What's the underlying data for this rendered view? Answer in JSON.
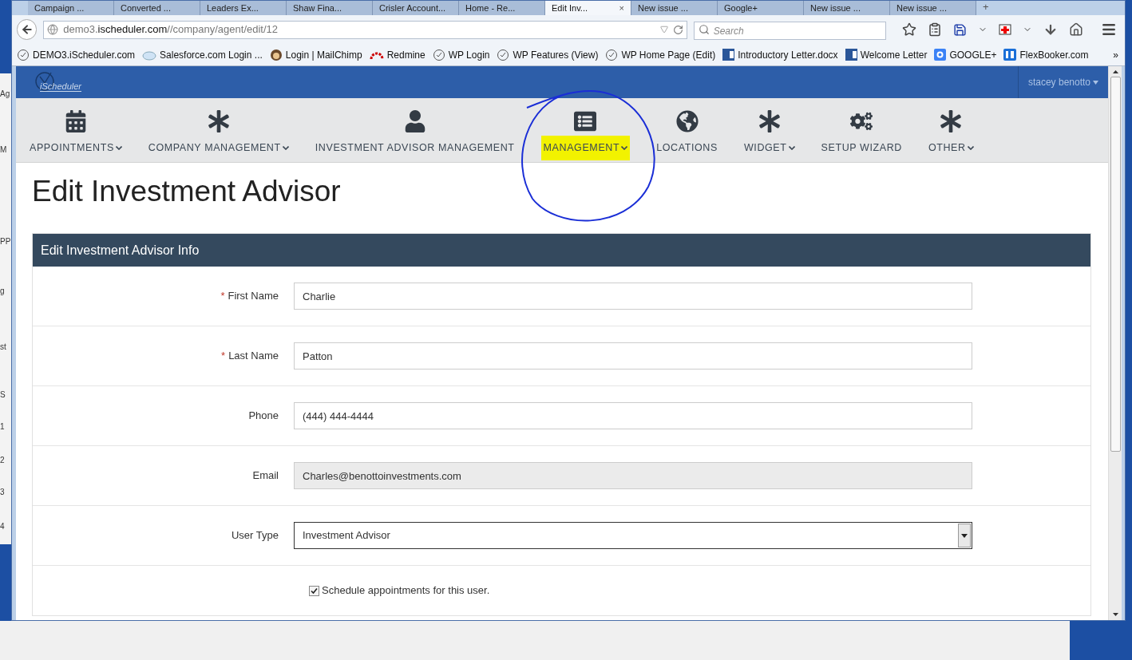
{
  "browser": {
    "tabs": [
      {
        "label": "Campaign ...",
        "selected": false
      },
      {
        "label": "Converted ...",
        "selected": false
      },
      {
        "label": "Leaders Ex...",
        "selected": false
      },
      {
        "label": "Shaw Fina...",
        "selected": false
      },
      {
        "label": "Crisler Account...",
        "selected": false
      },
      {
        "label": "Home - Re...",
        "selected": false
      },
      {
        "label": "Edit Inv...",
        "selected": true,
        "close": "×"
      },
      {
        "label": "New issue ...",
        "selected": false
      },
      {
        "label": "Google+",
        "selected": false
      },
      {
        "label": "New issue ...",
        "selected": false
      },
      {
        "label": "New issue ...",
        "selected": false
      }
    ],
    "new_tab": "+",
    "url": {
      "prefix": "demo3.",
      "host": "ischeduler.com",
      "path": "//company/agent/edit/12"
    },
    "search": {
      "placeholder": "Search"
    },
    "bookmarks": [
      {
        "label": "DEMO3.iScheduler.com",
        "kind": "clock"
      },
      {
        "label": "Salesforce.com Login ...",
        "kind": "cloud"
      },
      {
        "label": "Login | MailChimp",
        "kind": "chimp"
      },
      {
        "label": "Redmine",
        "kind": "redmine"
      },
      {
        "label": "WP Login",
        "kind": "clock"
      },
      {
        "label": "WP Features (View)",
        "kind": "clock"
      },
      {
        "label": "WP Home Page (Edit)",
        "kind": "clock"
      },
      {
        "label": "Introductory Letter.docx",
        "kind": "word"
      },
      {
        "label": "Welcome Letter",
        "kind": "word"
      },
      {
        "label": "GOOGLE+",
        "kind": "google"
      },
      {
        "label": "FlexBooker.com",
        "kind": "fb"
      }
    ],
    "overflow": "»"
  },
  "header": {
    "logo": "iScheduler",
    "user": "stacey benotto"
  },
  "menu": [
    {
      "label": "APPOINTMENTS",
      "kind": "calendar",
      "dropdown": true,
      "highlighted": false,
      "circled": false
    },
    {
      "label": "COMPANY MANAGEMENT",
      "kind": "asterisk",
      "dropdown": true,
      "highlighted": false,
      "circled": false
    },
    {
      "label": "INVESTMENT ADVISOR MANAGEMENT",
      "kind": "user",
      "dropdown": false,
      "highlighted": false,
      "circled": false
    },
    {
      "label": "MANAGEMENT",
      "kind": "list",
      "dropdown": true,
      "highlighted": true,
      "circled": true
    },
    {
      "label": "LOCATIONS",
      "kind": "globe",
      "dropdown": false,
      "highlighted": false,
      "circled": false
    },
    {
      "label": "WIDGET",
      "kind": "asterisk",
      "dropdown": true,
      "highlighted": false,
      "circled": false
    },
    {
      "label": "SETUP WIZARD",
      "kind": "cogs",
      "dropdown": false,
      "highlighted": false,
      "circled": false
    },
    {
      "label": "OTHER",
      "kind": "asterisk",
      "dropdown": true,
      "highlighted": false,
      "circled": false
    }
  ],
  "page_title": "Edit Investment Advisor",
  "panel": {
    "title": "Edit Investment Advisor Info",
    "required_mark": "*",
    "fields": [
      {
        "kind": "text",
        "label": "First Name",
        "required": true,
        "value": "Charlie",
        "disabled": false
      },
      {
        "kind": "text",
        "label": "Last Name",
        "required": true,
        "value": "Patton",
        "disabled": false
      },
      {
        "kind": "text",
        "label": "Phone",
        "required": false,
        "value": "(444) 444-4444",
        "disabled": false
      },
      {
        "kind": "text",
        "label": "Email",
        "required": false,
        "value": "Charles@benottoinvestments.com",
        "disabled": true
      },
      {
        "kind": "select",
        "label": "User Type",
        "required": false,
        "value": "Investment Advisor"
      },
      {
        "kind": "checkbox",
        "label": "Schedule appointments for this user.",
        "checked": true
      }
    ]
  },
  "background_window": [
    "Ag",
    "M",
    "PP",
    "g",
    "st",
    "S",
    "1",
    "2",
    "3",
    "4"
  ]
}
